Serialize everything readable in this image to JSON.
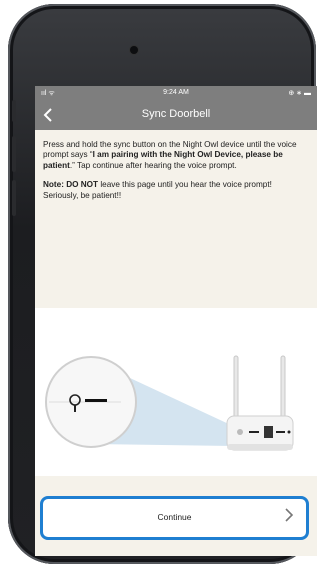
{
  "status_bar": {
    "signal": "ııl ᯤ",
    "time": "9:24 AM",
    "indicators": "⊕ ∗ ▬"
  },
  "nav": {
    "back_icon": "chevron-left-icon",
    "title": "Sync Doorbell"
  },
  "instructions": {
    "p1_pre": "Press and hold the sync button on the Night Owl device until the voice prompt says “",
    "p1_bold": "I am pairing with the Night Owl Device, please be patient",
    "p1_post": ".” Tap continue after hearing the voice prompt.",
    "note_bold": "Note: DO NOT",
    "note_rest": " leave this page until you hear the voice prompt! Seriously, be patient!!"
  },
  "footer": {
    "continue_label": "Continue",
    "continue_icon": "chevron-right-icon"
  },
  "colors": {
    "header": "#7e7e7e",
    "page_bg": "#f5f2ea",
    "button_border": "#1f7fd1"
  }
}
